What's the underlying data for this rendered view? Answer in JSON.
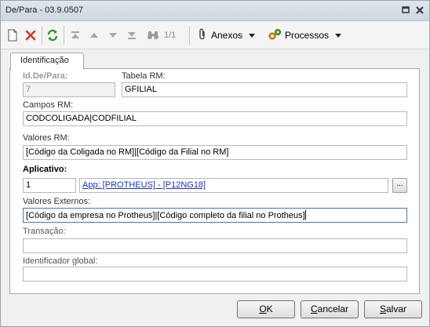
{
  "window": {
    "title": "De/Para - 03.9.0507"
  },
  "toolbar": {
    "pager_text": "1/1",
    "anexos_label": "Anexos",
    "processos_label": "Processos"
  },
  "tabs": [
    {
      "label": "Identificação"
    }
  ],
  "form": {
    "id_label": "Id.De/Para:",
    "id_value": "7",
    "tabela_label": "Tabela RM:",
    "tabela_value": "GFILIAL",
    "campos_label": "Campos RM:",
    "campos_value": "CODCOLIGADA|CODFILIAL",
    "valores_rm_label": "Valores RM:",
    "valores_rm_value": "[Código da Coligada no RM]|[Código da Filial no RM]",
    "aplicativo_label": "Aplicativo:",
    "aplicativo_code": "1",
    "aplicativo_desc": "App: [PROTHEUS] - [P12NG18]",
    "lookup_button": "...",
    "valores_ext_label": "Valores Externos:",
    "valores_ext_value": "[Código da empresa no Protheus]|[Código completo da filial no Protheus]",
    "transacao_label": "Transação:",
    "transacao_value": "",
    "identificador_label": "Identificador global:",
    "identificador_value": ""
  },
  "buttons": {
    "ok_acc": "O",
    "ok_rest": "K",
    "cancelar_acc": "C",
    "cancelar_rest": "ancelar",
    "salvar_acc": "S",
    "salvar_rest": "alvar"
  },
  "colors": {
    "accent": "#3c7fb1",
    "link": "#1a33cc",
    "delete_red": "#e0302a",
    "refresh_green": "#2a9a2a"
  }
}
